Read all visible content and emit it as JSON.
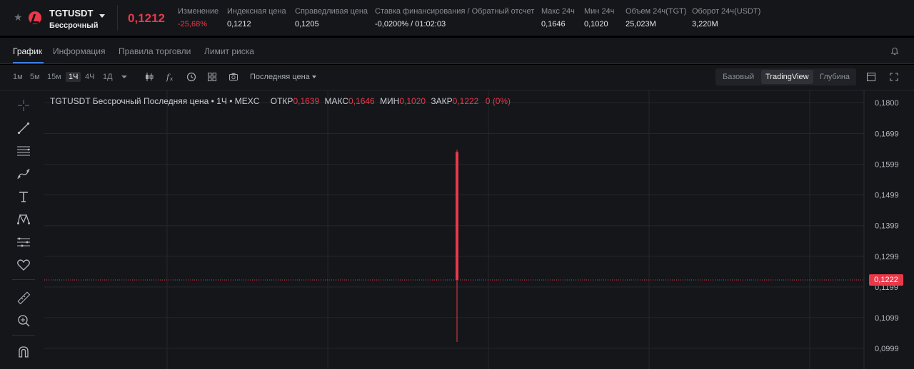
{
  "ticker": {
    "symbol": "TGTUSDT",
    "contract": "Бессрочный",
    "last_price": "0,1212",
    "stats": [
      {
        "label": "Изменение",
        "value": "-25,68%",
        "color": "red"
      },
      {
        "label": "Индексная цена",
        "value": "0,1212"
      },
      {
        "label": "Справедливая цена",
        "value": "0,1205"
      },
      {
        "label": "Ставка финансирования  /  Обратный отсчет",
        "value": "-0,0200%  /  01:02:03"
      },
      {
        "label": "Макс 24ч",
        "value": "0,1646"
      },
      {
        "label": "Мин 24ч",
        "value": "0,1020"
      },
      {
        "label": "Объем 24ч(TGT)",
        "value": "25,023M"
      },
      {
        "label": "Оборот 24ч(USDT)",
        "value": "3,220M"
      }
    ]
  },
  "tabs": [
    "График",
    "Информация",
    "Правила торговли",
    "Лимит риска"
  ],
  "toolbar": {
    "timeframes": [
      "1м",
      "5м",
      "15м",
      "1Ч",
      "4Ч",
      "1Д"
    ],
    "active_timeframe": "1Ч",
    "price_source": "Последняя цена",
    "views": [
      "Базовый",
      "TradingView",
      "Глубина"
    ],
    "active_view": "TradingView"
  },
  "tools": [
    "crosshair-icon",
    "trend-line-icon",
    "fib-lines-icon",
    "brush-icon",
    "text-icon",
    "pattern-icon",
    "prediction-icon",
    "heart-icon",
    "ruler-icon",
    "zoom-in-icon",
    "magnet-icon"
  ],
  "chart_data": {
    "type": "candlestick",
    "legend": {
      "title": "TGTUSDT Бессрочный Последняя цена • 1Ч • MEXC",
      "open_label": "ОТКР",
      "open": "0,1639",
      "high_label": "МАКС",
      "high": "0,1646",
      "low_label": "МИН",
      "low": "0,1020",
      "close_label": "ЗАКР",
      "close": "0,1222",
      "change": "0 (0%)"
    },
    "candles": [
      {
        "open": 0.1639,
        "high": 0.1646,
        "low": 0.102,
        "close": 0.1222
      }
    ],
    "y_ticks": [
      "0,1800",
      "0,1699",
      "0,1599",
      "0,1499",
      "0,1399",
      "0,1299",
      "0,1199",
      "0,1099",
      "0,0999"
    ],
    "y_tick_values": [
      0.18,
      0.1699,
      0.1599,
      0.1499,
      0.1399,
      0.1299,
      0.1199,
      0.1099,
      0.0999
    ],
    "current_price_label": "0,1222",
    "current_price": 0.1222,
    "colors": {
      "down": "#e8394a",
      "grid": "#24262b",
      "background": "#15161a"
    }
  }
}
